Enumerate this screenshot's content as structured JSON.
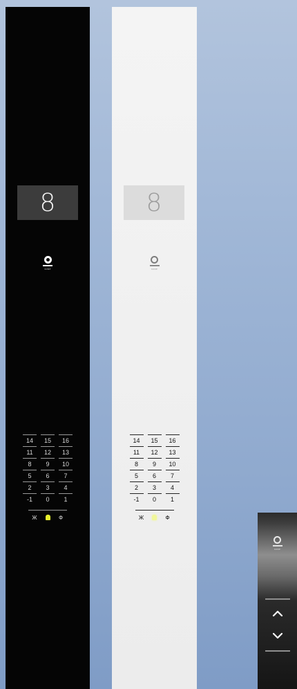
{
  "car_panels": [
    {
      "theme": "dark",
      "display_floor": "8",
      "logo_text": "KONE",
      "keypad_rows": [
        [
          "14",
          "15",
          "16"
        ],
        [
          "11",
          "12",
          "13"
        ],
        [
          "8",
          "9",
          "10"
        ],
        [
          "5",
          "6",
          "7"
        ],
        [
          "2",
          "3",
          "4"
        ],
        [
          "-1",
          "0",
          "1"
        ]
      ],
      "special_buttons": [
        "Ж",
        "alarm-bell-icon",
        "Ф"
      ],
      "alarm_color": "#e6f02c"
    },
    {
      "theme": "light",
      "display_floor": "8",
      "logo_text": "KONE",
      "keypad_rows": [
        [
          "14",
          "15",
          "16"
        ],
        [
          "11",
          "12",
          "13"
        ],
        [
          "8",
          "9",
          "10"
        ],
        [
          "5",
          "6",
          "7"
        ],
        [
          "2",
          "3",
          "4"
        ],
        [
          "-1",
          "0",
          "1"
        ]
      ],
      "special_buttons": [
        "Ж",
        "alarm-bell-icon",
        "Ф"
      ],
      "alarm_color": "#f1f79a"
    }
  ],
  "hall_station": {
    "logo_text": "KONE",
    "buttons": [
      "arrow-up-icon",
      "arrow-down-icon"
    ]
  }
}
